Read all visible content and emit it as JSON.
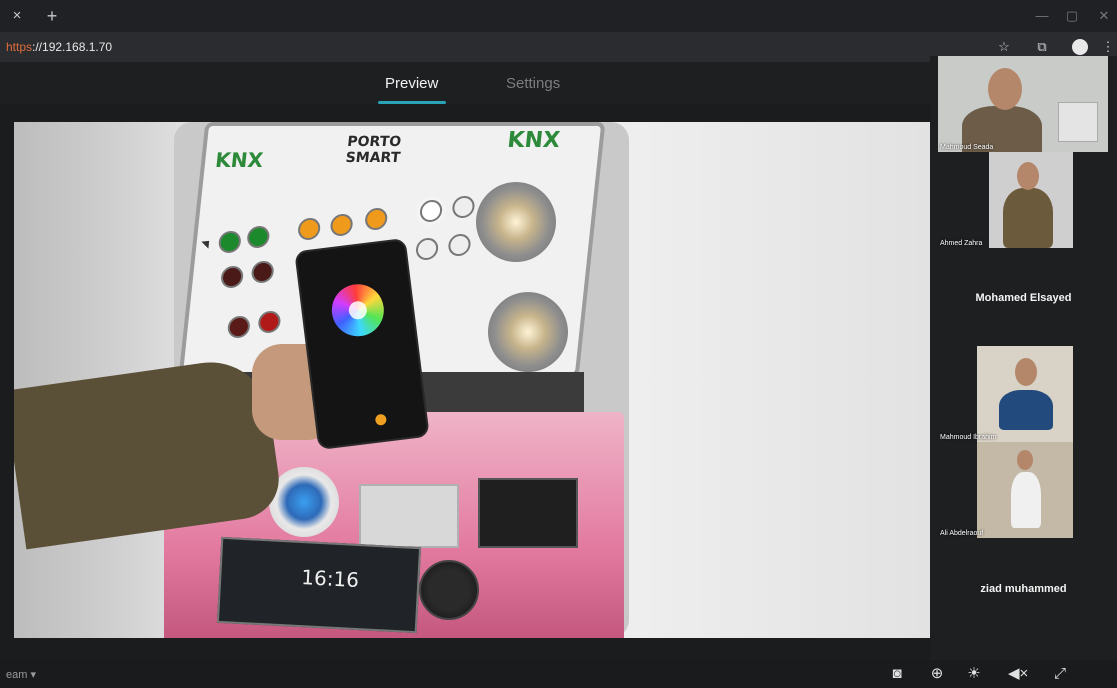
{
  "browser": {
    "tab_close": "×",
    "tab_new": "+",
    "window_controls": {
      "minimize": "—",
      "restore": "▢",
      "close": "✕"
    },
    "url_scheme": "https",
    "url_rest": "://192.168.1.70",
    "icons": {
      "bookmark": "star-icon",
      "extensions": "puzzle-icon",
      "profile": "avatar-icon",
      "menu": "kebab-icon"
    }
  },
  "view_tabs": [
    {
      "label": "Preview",
      "active": true
    },
    {
      "label": "Settings",
      "active": false
    }
  ],
  "video": {
    "display_clock": "16:16"
  },
  "participants": [
    {
      "name": "Mahmoud Seada",
      "has_video": true
    },
    {
      "name": "Ahmed Zahra",
      "has_video": true
    },
    {
      "name": "Mohamed Elsayed",
      "has_video": false
    },
    {
      "name": "Mahmoud Ibrahim",
      "has_video": true
    },
    {
      "name": "Ali Abdelraouf",
      "has_video": true
    },
    {
      "name": "ziad muhammed",
      "has_video": false
    }
  ],
  "bottom_bar": {
    "stream_label": "eam ▾",
    "icons": [
      "camera-icon",
      "zoom-in-icon",
      "light-icon",
      "volume-mute-icon",
      "fullscreen-icon"
    ]
  },
  "colors": {
    "accent": "#2aa5b8",
    "url_scheme": "#e06c3c"
  }
}
